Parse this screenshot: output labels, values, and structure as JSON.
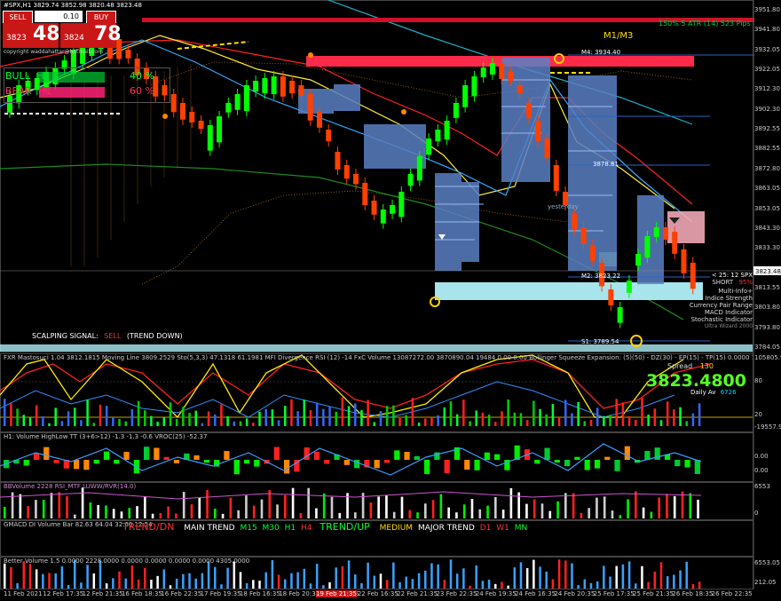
{
  "window": {
    "title": "#SPX,H1  3829.74 3852.98 3820.48 3823.48",
    "copyright": "copyright waddahattar@hotmail.com"
  },
  "trade_panel": {
    "sell_label": "SELL",
    "buy_label": "BUY",
    "lot_value": "0.10",
    "bid_small": "3823",
    "bid_big": "48",
    "ask_small": "3824",
    "ask_big": "78"
  },
  "bull_bear": {
    "bull_label": "BULL",
    "bull_tf": "H1",
    "bull_pct": "40 %",
    "bear_label": "BEAR",
    "bear_tf": "H1",
    "bear_pct": "60 %"
  },
  "main_chart": {
    "top_right_info": "150% 5 ATR (14) 523 Pips",
    "timeframe_label": "M1/M3",
    "m4_label": "M4: 3934.40",
    "m3_label": "3878.81",
    "m2_label": "M2: 3823.22",
    "s1_label": "S1: 3789.54",
    "yesterday_label": "yesterday",
    "scalping_label": "SCALPING SIGNAL:",
    "scalping_value": "SELL",
    "scalping_trend": "(TREND DOWN)",
    "info_price_label": "< 25: 12 SPX",
    "short_label": "SHORT",
    "short_pct": "95%",
    "info_lines": [
      "Multi-Info+",
      "Indice Strength",
      "Currency Pair Range",
      "MACD Indicator",
      "Stochastic Indicator",
      "Ultra Wizard 2000"
    ],
    "current_price": "3823.48",
    "price_axis": [
      "3951.80",
      "3941.80",
      "3932.05",
      "3922.05",
      "3912.30",
      "3902.30",
      "3892.55",
      "3882.55",
      "3872.80",
      "3863.05",
      "3853.05",
      "3843.30",
      "3833.30",
      "3823.48",
      "3813.55",
      "3803.80",
      "3793.80",
      "3784.05"
    ],
    "colors": {
      "bull": "#00ff00",
      "bear": "#ff4000",
      "volume_profile": "#5a7fc4",
      "resistance": "#ff2a4a",
      "support": "#b0f0f8"
    }
  },
  "panel1": {
    "title": "FXR  Mastosuci 1.04  3812.1815 Moving Line 3809.2529  Sto(5,3,3) 47.1318 61.1981  MFI Divergence  RSI (12)  -14  FxC Volume 13087272.00  3870890.04  19484  0.00 0.00  Bollinger Squeeze Expansion: (5)(50) - DZ(30) - EP(15) - TP(15)  0.0000 113.5279 163.9495 6.3",
    "spread_label": "Spread",
    "spread_value": "130",
    "big_price": "3823.4800",
    "daily_av_label": "Daily Av",
    "daily_av_value": "6726",
    "axis": [
      "105805.94",
      "80",
      "20",
      "-19557.93"
    ]
  },
  "panel2": {
    "title": "H1: Volume HighLow TT (3+6>12)  -1.3  -1.3  -0.6  VROC(25) -52.37",
    "axis": [
      "0.00",
      "0.00"
    ]
  },
  "panel3": {
    "title": "BBVolume 2228  RSI_MTF  LUWW/RVR(14.0)",
    "axis": [
      "6553",
      "0"
    ]
  },
  "panel4": {
    "title": "GMACD  DI  Volume Bar 82.63  64.04  32.60  12.54",
    "trend_down": "TREND/DN",
    "main_trend": "MAIN TREND",
    "m15": "M15",
    "m30": "M30",
    "h1": "H1",
    "h4": "H4",
    "trend_up": "TREND/UP",
    "medium": "MEDIUM",
    "major_trend": "MAJOR TREND",
    "d1": "D1",
    "w1": "W1",
    "mn": "MN"
  },
  "panel5": {
    "title": "Better Volume 1.5  0.0000  2228.0000  0.0000  0.0000  0.0000  0.0000  4305.0000",
    "axis": [
      "6553.05",
      "212.05"
    ]
  },
  "time_axis": [
    "11 Feb 2021",
    "12 Feb 17:35",
    "12 Feb 21:35",
    "16 Feb 18:35",
    "16 Feb 22:35",
    "17 Feb 19:35",
    "18 Feb 16:35",
    "18 Feb 20:35",
    "19 Feb 17:35",
    "22 Feb 16:35",
    "22 Feb 21:35",
    "23 Feb 22:35",
    "24 Feb 19:35",
    "24 Feb 16:35",
    "24 Feb 20:35",
    "25 Feb 17:35",
    "25 Feb 21:35",
    "26 Feb 18:35",
    "26 Feb 22:35"
  ],
  "time_highlight": "19 Feb 21:35"
}
